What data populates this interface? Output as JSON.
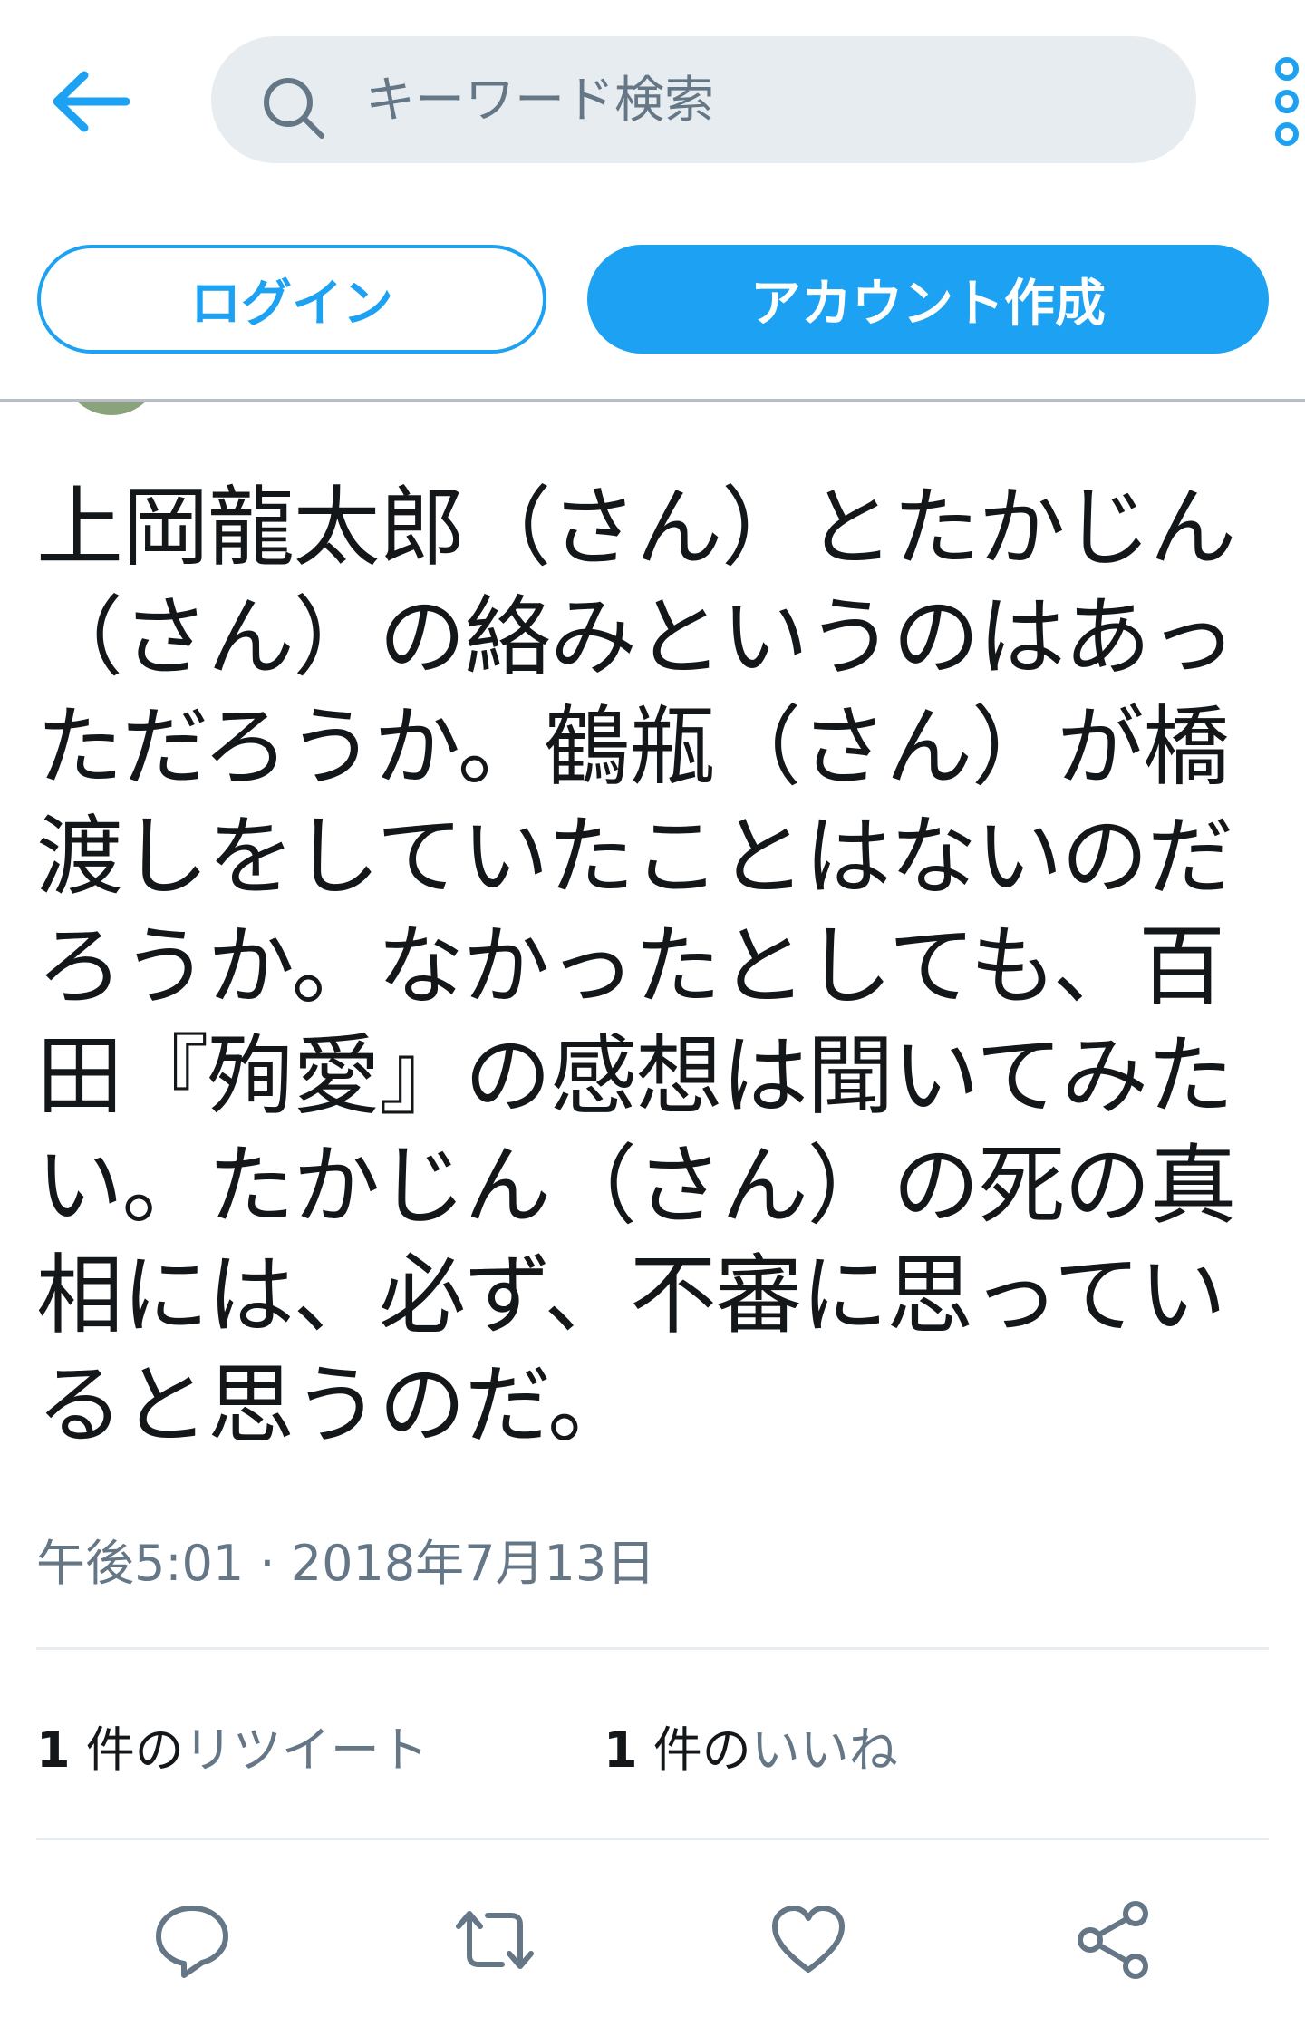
{
  "header": {
    "back_icon": "arrow-left-icon",
    "search": {
      "placeholder": "キーワード検索",
      "icon": "search-icon"
    },
    "more_icon": "vertical-dots-icon"
  },
  "auth": {
    "login_label": "ログイン",
    "signup_label": "アカウント作成"
  },
  "tweet": {
    "text": "上岡龍太郎（さん）とたかじん（さん）の絡みというのはあっただろうか。鶴瓶（さん）が橋渡しをしていたことはないのだろうか。なかったとしても、百田『殉愛』の感想は聞いてみたい。たかじん（さん）の死の真相には、必ず、不審に思っていると思うのだ。",
    "timestamp": "午後5:01 · 2018年7月13日"
  },
  "stats": {
    "retweets": {
      "count": "1",
      "unit": " 件の",
      "label": "リツイート"
    },
    "likes": {
      "count": "1",
      "unit": " 件の",
      "label": "いいね"
    }
  },
  "actions": [
    "reply-icon",
    "retweet-icon",
    "like-icon",
    "share-icon"
  ],
  "colors": {
    "accent": "#1da1f2",
    "secondary_text": "#657786",
    "search_bg": "#e6ecf0"
  }
}
